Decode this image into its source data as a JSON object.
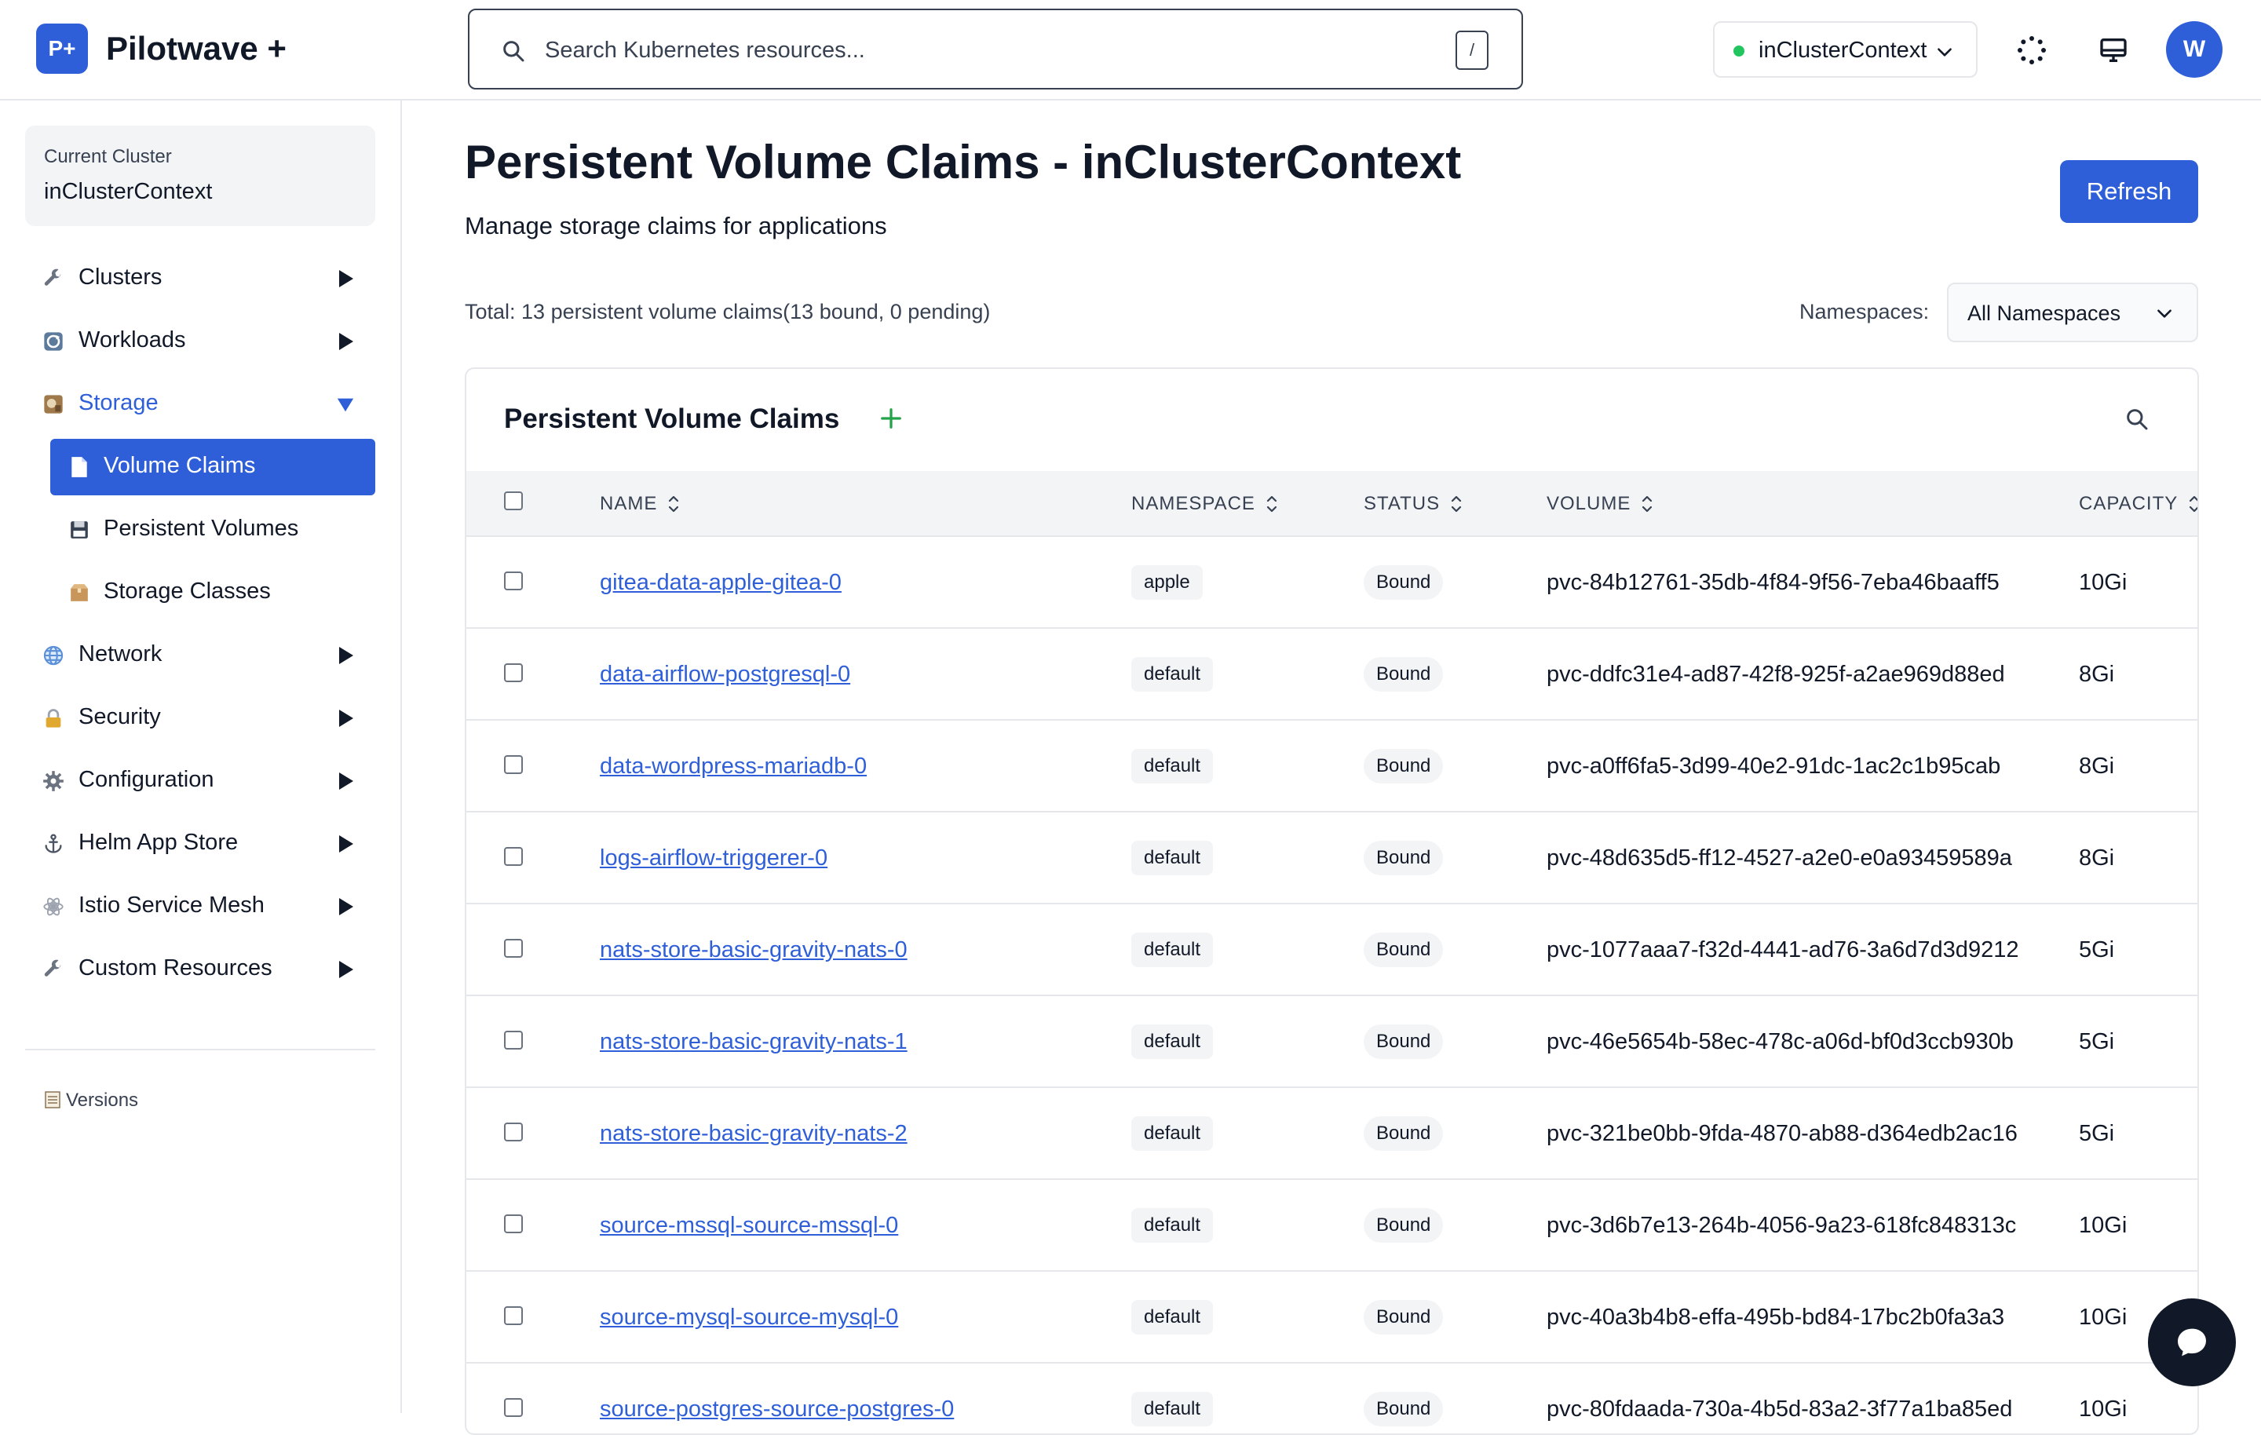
{
  "header": {
    "logo_text": "P+",
    "brand": "Pilotwave +",
    "search_placeholder": "Search Kubernetes resources...",
    "search_shortcut": "/",
    "context": "inClusterContext",
    "context_status_color": "#22c55e",
    "avatar_initial": "W",
    "icons": [
      "search-icon",
      "loading-spinner-icon",
      "monitor-icon",
      "chevron-down-icon"
    ]
  },
  "sidebar": {
    "cluster_card": {
      "label": "Current Cluster",
      "value": "inClusterContext"
    },
    "items": [
      {
        "label": "Clusters",
        "icon": "wrench-icon",
        "expanded": false
      },
      {
        "label": "Workloads",
        "icon": "workloads-icon",
        "expanded": false
      },
      {
        "label": "Storage",
        "icon": "storage-icon",
        "expanded": true,
        "active": true
      },
      {
        "label": "Network",
        "icon": "globe-icon",
        "expanded": false
      },
      {
        "label": "Security",
        "icon": "lock-icon",
        "expanded": false
      },
      {
        "label": "Configuration",
        "icon": "gear-icon",
        "expanded": false
      },
      {
        "label": "Helm App Store",
        "icon": "anchor-icon",
        "expanded": false
      },
      {
        "label": "Istio Service Mesh",
        "icon": "mesh-icon",
        "expanded": false
      },
      {
        "label": "Custom Resources",
        "icon": "wrench-icon",
        "expanded": false
      }
    ],
    "storage_children": [
      {
        "label": "Volume Claims",
        "icon": "document-icon",
        "active": true
      },
      {
        "label": "Persistent Volumes",
        "icon": "disk-icon",
        "active": false
      },
      {
        "label": "Storage Classes",
        "icon": "box-icon",
        "active": false
      }
    ],
    "footer": {
      "label": "Versions",
      "icon": "ledger-icon"
    }
  },
  "main": {
    "title": "Persistent Volume Claims - inClusterContext",
    "subtitle": "Manage storage claims for applications",
    "refresh_label": "Refresh",
    "summary": "Total: 13 persistent volume claims(13 bound, 0 pending)",
    "namespace_label": "Namespaces:",
    "namespace_value": "All Namespaces",
    "accent_color": "#2f5fd8"
  },
  "table": {
    "title": "Persistent Volume Claims",
    "columns": [
      "NAME",
      "NAMESPACE",
      "STATUS",
      "VOLUME",
      "CAPACITY"
    ],
    "rows": [
      {
        "name": "gitea-data-apple-gitea-0",
        "namespace": "apple",
        "status": "Bound",
        "volume": "pvc-84b12761-35db-4f84-9f56-7eba46baaff5",
        "capacity": "10Gi"
      },
      {
        "name": "data-airflow-postgresql-0",
        "namespace": "default",
        "status": "Bound",
        "volume": "pvc-ddfc31e4-ad87-42f8-925f-a2ae969d88ed",
        "capacity": "8Gi"
      },
      {
        "name": "data-wordpress-mariadb-0",
        "namespace": "default",
        "status": "Bound",
        "volume": "pvc-a0ff6fa5-3d99-40e2-91dc-1ac2c1b95cab",
        "capacity": "8Gi"
      },
      {
        "name": "logs-airflow-triggerer-0",
        "namespace": "default",
        "status": "Bound",
        "volume": "pvc-48d635d5-ff12-4527-a2e0-e0a93459589a",
        "capacity": "8Gi"
      },
      {
        "name": "nats-store-basic-gravity-nats-0",
        "namespace": "default",
        "status": "Bound",
        "volume": "pvc-1077aaa7-f32d-4441-ad76-3a6d7d3d9212",
        "capacity": "5Gi"
      },
      {
        "name": "nats-store-basic-gravity-nats-1",
        "namespace": "default",
        "status": "Bound",
        "volume": "pvc-46e5654b-58ec-478c-a06d-bf0d3ccb930b",
        "capacity": "5Gi"
      },
      {
        "name": "nats-store-basic-gravity-nats-2",
        "namespace": "default",
        "status": "Bound",
        "volume": "pvc-321be0bb-9fda-4870-ab88-d364edb2ac16",
        "capacity": "5Gi"
      },
      {
        "name": "source-mssql-source-mssql-0",
        "namespace": "default",
        "status": "Bound",
        "volume": "pvc-3d6b7e13-264b-4056-9a23-618fc848313c",
        "capacity": "10Gi"
      },
      {
        "name": "source-mysql-source-mysql-0",
        "namespace": "default",
        "status": "Bound",
        "volume": "pvc-40a3b4b8-effa-495b-bd84-17bc2b0fa3a3",
        "capacity": "10Gi"
      },
      {
        "name": "source-postgres-source-postgres-0",
        "namespace": "default",
        "status": "Bound",
        "volume": "pvc-80fdaada-730a-4b5d-83a2-3f77a1ba85ed",
        "capacity": "10Gi"
      }
    ]
  }
}
